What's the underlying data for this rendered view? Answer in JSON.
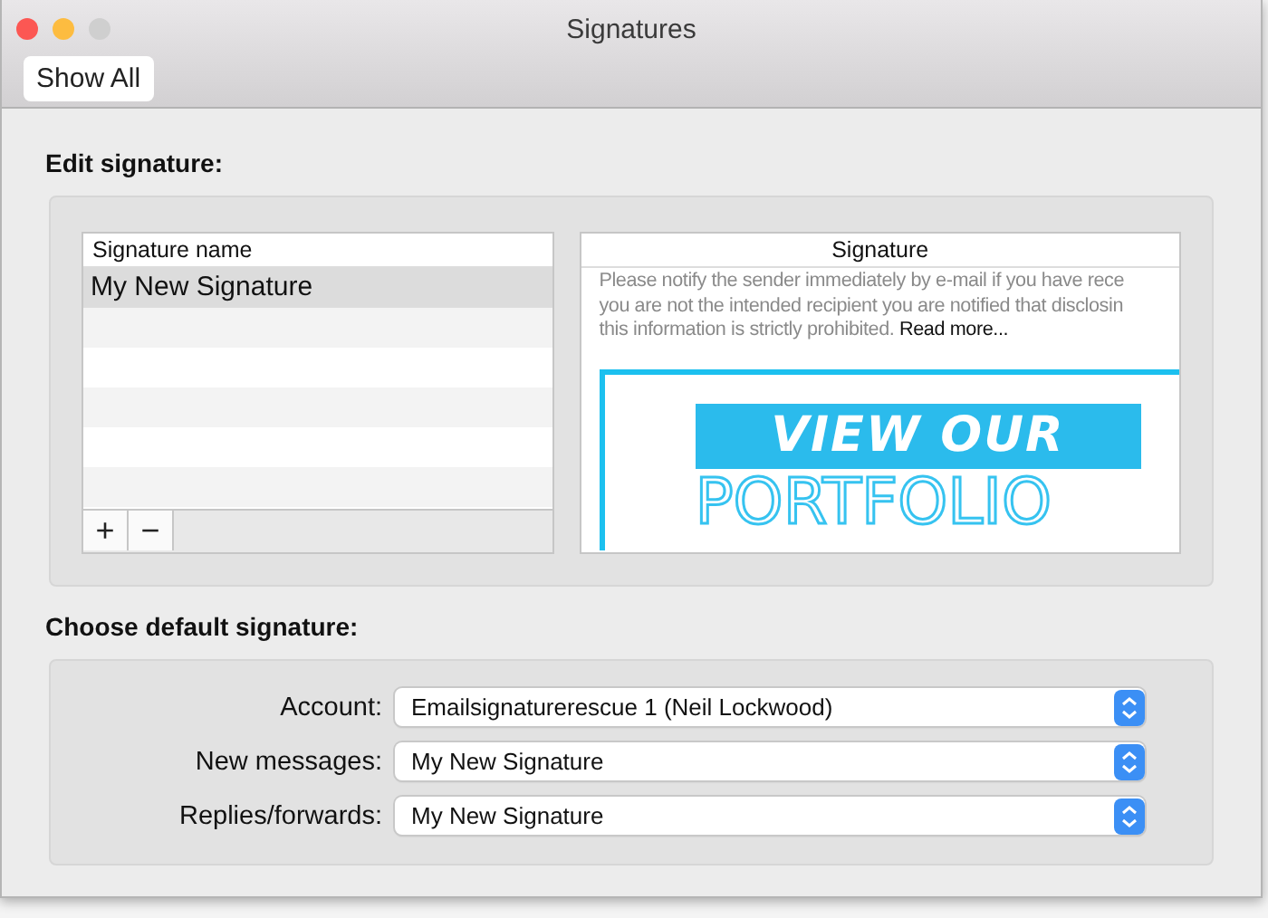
{
  "window": {
    "title": "Signatures",
    "controls": [
      {
        "color": "#fc5753"
      },
      {
        "color": "#fdbc40"
      },
      {
        "color": "#cfcfcf"
      }
    ]
  },
  "toolbar": {
    "show_all": "Show All"
  },
  "edit_section": {
    "heading": "Edit signature:",
    "list": {
      "header": "Signature name",
      "items": [
        {
          "name": "My New Signature",
          "selected": true
        }
      ],
      "add": "+",
      "remove": "−"
    },
    "preview": {
      "header": "Signature",
      "lines": [
        "Please notify the sender immediately by e-mail if you have rece",
        "you are not the intended recipient you are notified that disclosin",
        "this information is strictly prohibited."
      ],
      "link": "Read more...",
      "banner": {
        "line1": "VIEW OUR",
        "line2": "PORTFOLIO"
      }
    }
  },
  "default_section": {
    "heading": "Choose default signature:",
    "fields": [
      {
        "label": "Account:",
        "value": "Emailsignaturerescue 1 (Neil Lockwood)"
      },
      {
        "label": "New messages:",
        "value": "My New Signature"
      },
      {
        "label": "Replies/forwards:",
        "value": "My New Signature"
      }
    ]
  }
}
